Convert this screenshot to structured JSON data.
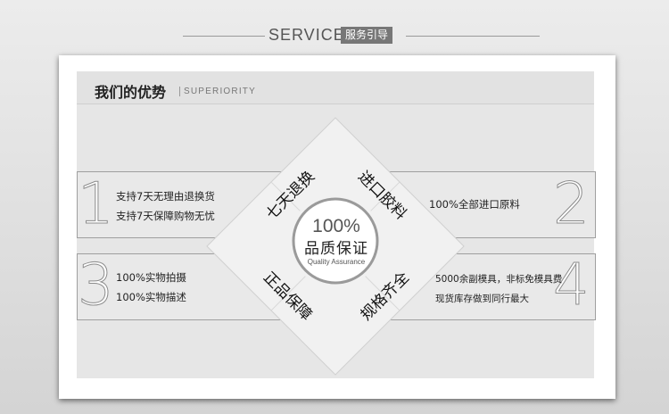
{
  "header": {
    "title": "SERVICE",
    "badge": "服务引导"
  },
  "section": {
    "title": "我们的优势",
    "subtitle": "SUPERIORITY"
  },
  "features": [
    {
      "number": "1",
      "lines": [
        "支持7天无理由退换货",
        "支持7天保障购物无忧"
      ]
    },
    {
      "number": "2",
      "lines": [
        "100%全部进口原料"
      ]
    },
    {
      "number": "3",
      "lines": [
        "100%实物拍摄",
        "100%实物描述"
      ]
    },
    {
      "number": "4",
      "lines": [
        "5000余副模具，非标免模具费",
        "现货库存做到同行最大"
      ]
    }
  ],
  "diamond": {
    "labels": [
      "七天退换",
      "进口胶料",
      "正品保障",
      "规格齐全"
    ],
    "center_pct": "100%",
    "center_zh": "品质保证",
    "center_en": "Quality Assurance"
  }
}
